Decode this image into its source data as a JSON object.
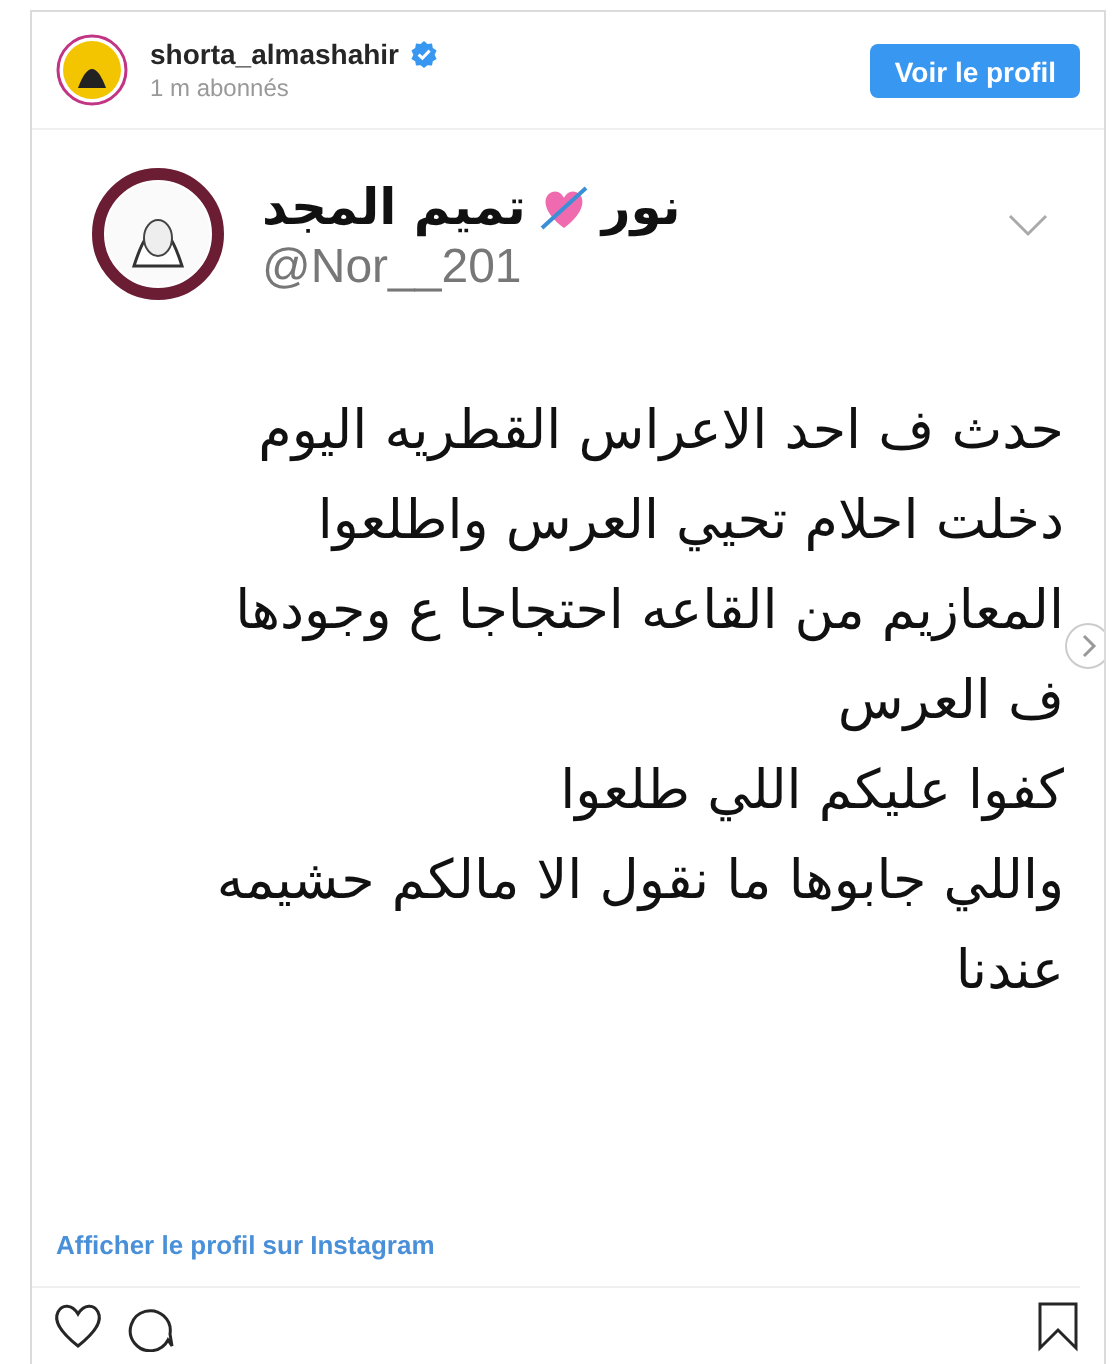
{
  "header": {
    "username": "shorta_almashahir",
    "verified": true,
    "followers": "1 m abonnés",
    "button": "Voir le profil"
  },
  "tweet": {
    "name_parts": [
      "نور",
      "تميم المجد"
    ],
    "handle": "@Nor__201",
    "lines": [
      "حدث ف احد الاعراس القطريه اليوم",
      "دخلت احلام تحيي العرس واطلعوا",
      "المعازيم من القاعه احتجاجا ع وجودها",
      "ف العرس",
      "كفوا عليكم اللي طلعوا",
      "واللي جابوها ما نقول الا مالكم حشيمه",
      "عندنا"
    ]
  },
  "link": "Afficher le profil sur Instagram"
}
